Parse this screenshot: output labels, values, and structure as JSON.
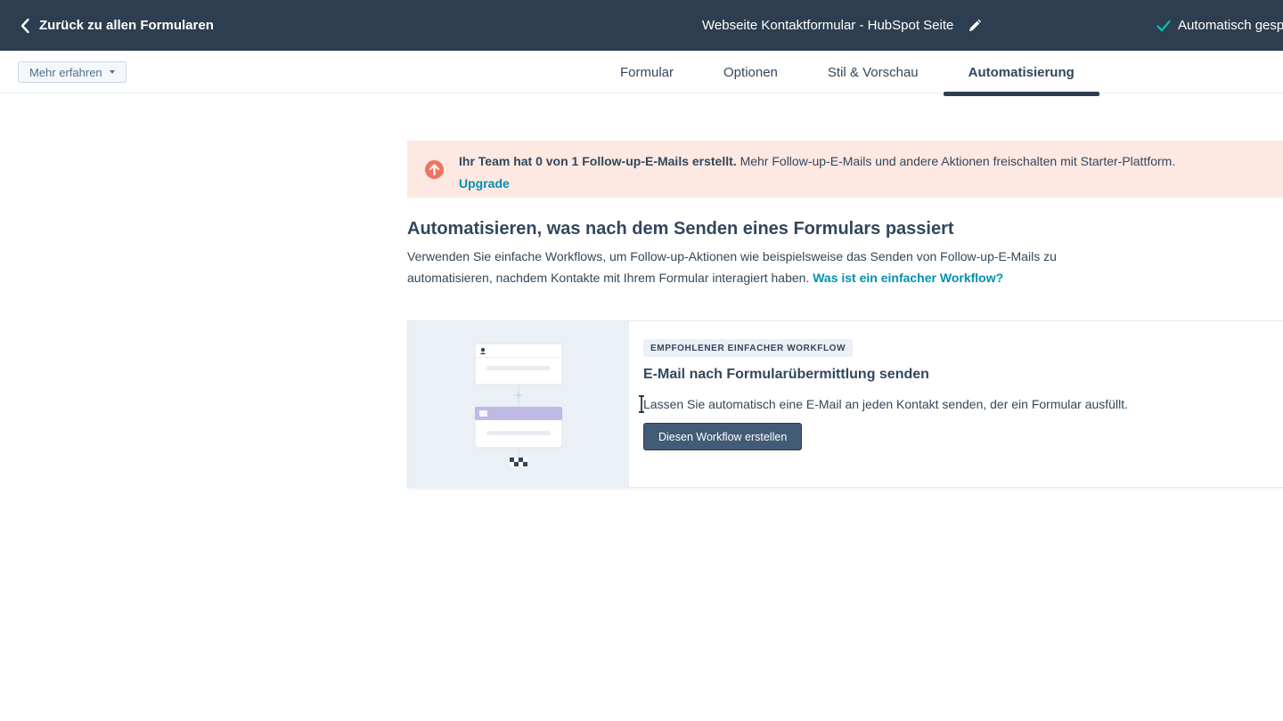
{
  "header": {
    "back_label": "Zurück zu allen Formularen",
    "page_title": "Webseite Kontaktformular - HubSpot Seite",
    "autosave_label": "Automatisch gesp"
  },
  "subnav": {
    "learn_more_label": "Mehr erfahren",
    "tabs": [
      {
        "label": "Formular"
      },
      {
        "label": "Optionen"
      },
      {
        "label": "Stil & Vorschau"
      },
      {
        "label": "Automatisierung",
        "active": true
      }
    ]
  },
  "banner": {
    "bold_text": "Ihr Team hat 0 von 1 Follow-up-E-Mails erstellt.",
    "text": " Mehr Follow-up-E-Mails und andere Aktionen freischalten mit Starter-Plattform. ",
    "link_label": "Upgrade"
  },
  "section": {
    "title": "Automatisieren, was nach dem Senden eines Formulars passiert",
    "description": "Verwenden Sie einfache Workflows, um Follow-up-Aktionen wie beispielsweise das Senden von Follow-up-E-Mails zu automatisieren, nachdem Kontakte mit Ihrem Formular interagiert haben. ",
    "link_label": "Was ist ein einfacher Workflow?"
  },
  "card": {
    "tag": "EMPFOHLENER EINFACHER WORKFLOW",
    "title": "E-Mail nach Formularübermittlung senden",
    "description": "Lassen Sie automatisch eine E-Mail an jeden Kontakt senden, der ein Formular ausfüllt.",
    "button_label": "Diesen Workflow erstellen"
  },
  "colors": {
    "header_bg": "#2d3e50",
    "banner_bg": "#fde8e2",
    "banner_icon": "#f2735d",
    "link": "#0091ae",
    "check": "#00bda5",
    "button_bg": "#425b76"
  }
}
